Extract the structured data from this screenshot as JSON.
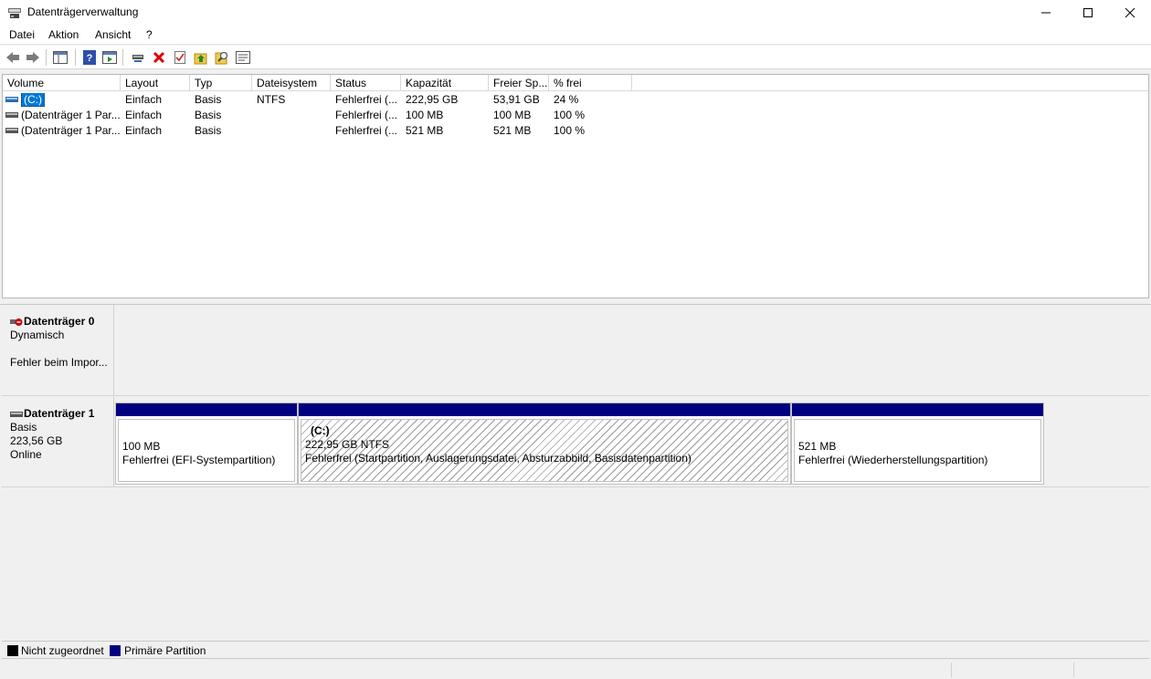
{
  "window": {
    "title": "Datenträgerverwaltung"
  },
  "menu": {
    "items": [
      "Datei",
      "Aktion",
      "Ansicht",
      "?"
    ]
  },
  "toolbar": {
    "icons": [
      "back-icon",
      "forward-icon",
      "console-tree-icon",
      "help-icon",
      "properties-icon",
      "connect-icon",
      "delete-icon",
      "checklist-icon",
      "folder-up-icon",
      "search-icon",
      "list-icon"
    ]
  },
  "volume_list": {
    "columns": [
      "Volume",
      "Layout",
      "Typ",
      "Dateisystem",
      "Status",
      "Kapazität",
      "Freier Sp...",
      "% frei"
    ],
    "rows": [
      {
        "volume": "(C:)",
        "layout": "Einfach",
        "typ": "Basis",
        "dateisystem": "NTFS",
        "status": "Fehlerfrei (...",
        "kapazitaet": "222,95 GB",
        "frei": "53,91 GB",
        "prozent": "24 %",
        "selected": true
      },
      {
        "volume": "(Datenträger 1 Par...",
        "layout": "Einfach",
        "typ": "Basis",
        "dateisystem": "",
        "status": "Fehlerfrei (...",
        "kapazitaet": "100 MB",
        "frei": "100 MB",
        "prozent": "100 %",
        "selected": false
      },
      {
        "volume": "(Datenträger 1 Par...",
        "layout": "Einfach",
        "typ": "Basis",
        "dateisystem": "",
        "status": "Fehlerfrei (...",
        "kapazitaet": "521 MB",
        "frei": "521 MB",
        "prozent": "100 %",
        "selected": false
      }
    ]
  },
  "disks": [
    {
      "name": "Datenträger 0",
      "type": "Dynamisch",
      "size": "",
      "state": "Fehler beim Impor...",
      "icon": "disk-error-icon"
    },
    {
      "name": "Datenträger 1",
      "type": "Basis",
      "size": "223,56 GB",
      "state": "Online",
      "icon": "disk-icon",
      "partitions": [
        {
          "label": "",
          "size": "100 MB",
          "status": "Fehlerfrei (EFI-Systempartition)"
        },
        {
          "label": "(C:)",
          "size": "222,95 GB NTFS",
          "status": "Fehlerfrei (Startpartition, Auslagerungsdatei, Absturzabbild, Basisdatenpartition)"
        },
        {
          "label": "",
          "size": "521 MB",
          "status": "Fehlerfrei (Wiederherstellungspartition)"
        }
      ]
    }
  ],
  "legend": [
    {
      "label": "Nicht zugeordnet",
      "color": "#000000"
    },
    {
      "label": "Primäre Partition",
      "color": "#000080"
    }
  ],
  "colors": {
    "primary_partition": "#000080",
    "selection": "#0078d7"
  }
}
